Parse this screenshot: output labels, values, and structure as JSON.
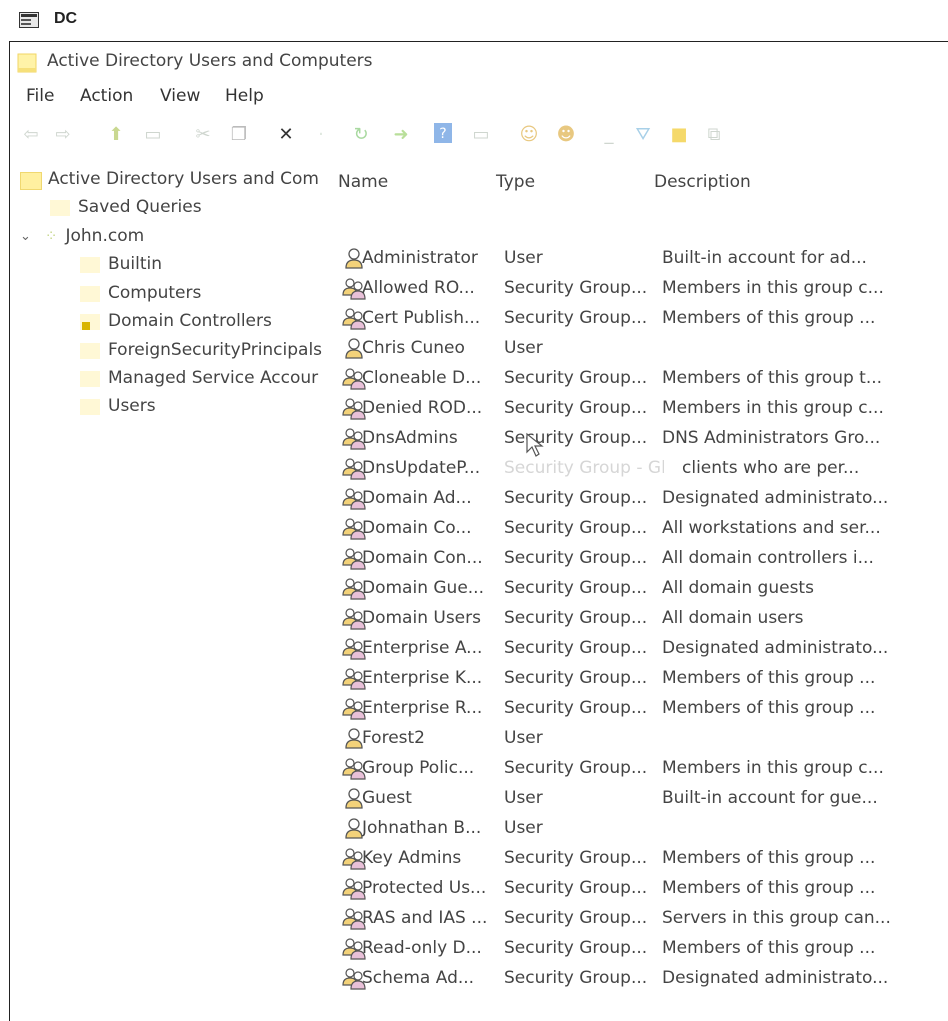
{
  "outer": {
    "title": "DC"
  },
  "window": {
    "title": "Active Directory Users and Computers"
  },
  "menu": [
    "File",
    "Action",
    "View",
    "Help"
  ],
  "tree": {
    "root": "Active Directory Users and Com",
    "items": [
      {
        "label": "Saved Queries",
        "level": 1
      },
      {
        "label": "John.com",
        "level": 1
      },
      {
        "label": "Builtin",
        "level": 2
      },
      {
        "label": "Computers",
        "level": 2
      },
      {
        "label": "Domain Controllers",
        "level": 2
      },
      {
        "label": "ForeignSecurityPrincipals",
        "level": 2
      },
      {
        "label": "Managed Service Accour",
        "level": 2
      },
      {
        "label": "Users",
        "level": 2
      }
    ]
  },
  "columns": {
    "name": "Name",
    "type": "Type",
    "description": "Description"
  },
  "rows": [
    {
      "name": "Administrator",
      "type": "User",
      "desc": "Built-in account for ad...",
      "kind": "user"
    },
    {
      "name": "Allowed RO...",
      "type": "Security Group...",
      "desc": "Members in this group c...",
      "kind": "group"
    },
    {
      "name": "Cert Publish...",
      "type": "Security Group...",
      "desc": "Members of this group ...",
      "kind": "group"
    },
    {
      "name": "Chris Cuneo",
      "type": "User",
      "desc": "",
      "kind": "user"
    },
    {
      "name": "Cloneable D...",
      "type": "Security Group...",
      "desc": "Members of this group t...",
      "kind": "group"
    },
    {
      "name": "Denied ROD...",
      "type": "Security Group...",
      "desc": "Members in this group c...",
      "kind": "group"
    },
    {
      "name": "DnsAdmins",
      "type": "Security Group...",
      "desc": "DNS Administrators Gro...",
      "kind": "group"
    },
    {
      "name": "DnsUpdateP...",
      "type": "Security Group - Global",
      "desc": "clients who are per...",
      "kind": "group",
      "faded": true
    },
    {
      "name": "Domain Ad...",
      "type": "Security Group...",
      "desc": "Designated administrato...",
      "kind": "group"
    },
    {
      "name": "Domain Co...",
      "type": "Security Group...",
      "desc": "All workstations and ser...",
      "kind": "group"
    },
    {
      "name": "Domain Con...",
      "type": "Security Group...",
      "desc": "All domain controllers i...",
      "kind": "group"
    },
    {
      "name": "Domain Gue...",
      "type": "Security Group...",
      "desc": "All domain guests",
      "kind": "group"
    },
    {
      "name": "Domain Users",
      "type": "Security Group...",
      "desc": "All domain users",
      "kind": "group"
    },
    {
      "name": "Enterprise A...",
      "type": "Security Group...",
      "desc": "Designated administrato...",
      "kind": "group"
    },
    {
      "name": "Enterprise K...",
      "type": "Security Group...",
      "desc": "Members of this group ...",
      "kind": "group"
    },
    {
      "name": "Enterprise R...",
      "type": "Security Group...",
      "desc": "Members of this group ...",
      "kind": "group"
    },
    {
      "name": "Forest2",
      "type": "User",
      "desc": "",
      "kind": "user"
    },
    {
      "name": "Group Polic...",
      "type": "Security Group...",
      "desc": "Members in this group c...",
      "kind": "group"
    },
    {
      "name": "Guest",
      "type": "User",
      "desc": "Built-in account for gue...",
      "kind": "user"
    },
    {
      "name": "Johnathan B...",
      "type": "User",
      "desc": "",
      "kind": "user"
    },
    {
      "name": "Key Admins",
      "type": "Security Group...",
      "desc": "Members of this group ...",
      "kind": "group"
    },
    {
      "name": "Protected Us...",
      "type": "Security Group...",
      "desc": "Members of this group ...",
      "kind": "group"
    },
    {
      "name": "RAS and IAS ...",
      "type": "Security Group...",
      "desc": "Servers in this group can...",
      "kind": "group"
    },
    {
      "name": "Read-only D...",
      "type": "Security Group...",
      "desc": "Members of this group ...",
      "kind": "group"
    },
    {
      "name": "Schema Ad...",
      "type": "Security Group...",
      "desc": "Designated administrato...",
      "kind": "group"
    }
  ]
}
